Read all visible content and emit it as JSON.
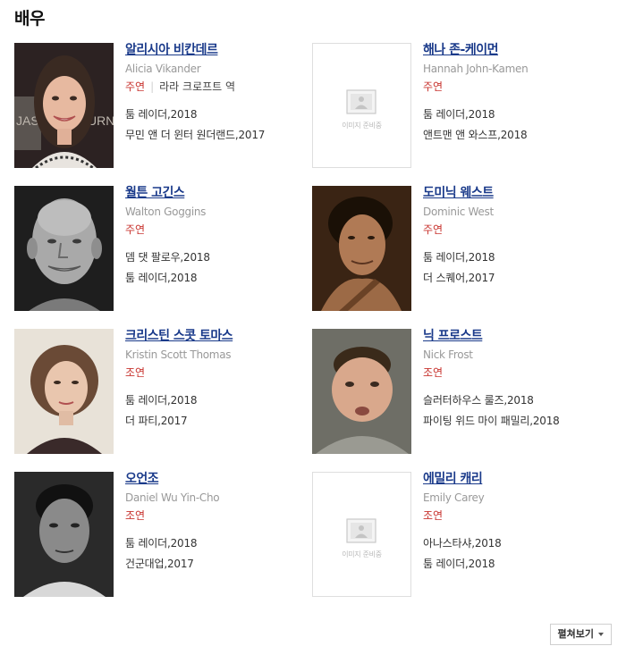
{
  "section": {
    "title": "배우"
  },
  "no_image_text": "이미지 준비중",
  "cast": [
    {
      "name": "알리시아 비칸데르",
      "english": "Alicia Vikander",
      "role": "주연",
      "character": "라라 크로프트 역",
      "works": [
        "툼 레이더,2018",
        "무민 앤 더 윈터 원더랜드,2017"
      ],
      "photo": "woman-long-dark-hair"
    },
    {
      "name": "해나 존-케이먼",
      "english": "Hannah John-Kamen",
      "role": "주연",
      "character": "",
      "works": [
        "툼 레이더,2018",
        "앤트맨 앤 와스프,2018"
      ],
      "photo": "placeholder"
    },
    {
      "name": "월튼 고긴스",
      "english": "Walton Goggins",
      "role": "주연",
      "character": "",
      "works": [
        "뎀 댓 팔로우,2018",
        "툼 레이더,2018"
      ],
      "photo": "man-bald-bw"
    },
    {
      "name": "도미닉 웨스트",
      "english": "Dominic West",
      "role": "주연",
      "character": "",
      "works": [
        "툼 레이더,2018",
        "더 스퀘어,2017"
      ],
      "photo": "man-dark-curly"
    },
    {
      "name": "크리스틴 스콧 토마스",
      "english": "Kristin Scott Thomas",
      "role": "조연",
      "character": "",
      "works": [
        "툼 레이더,2018",
        "더 파티,2017"
      ],
      "photo": "woman-short-hair"
    },
    {
      "name": "닉 프로스트",
      "english": "Nick Frost",
      "role": "조연",
      "character": "",
      "works": [
        "슬러터하우스 룰즈,2018",
        "파이팅 위드 마이 패밀리,2018"
      ],
      "photo": "man-round-face"
    },
    {
      "name": "오언조",
      "english": "Daniel Wu Yin-Cho",
      "role": "조연",
      "character": "",
      "works": [
        "툼 레이더,2018",
        "건군대업,2017"
      ],
      "photo": "man-bw-young"
    },
    {
      "name": "에밀리 캐리",
      "english": "Emily Carey",
      "role": "조연",
      "character": "",
      "works": [
        "아나스타샤,2018",
        "툼 레이더,2018"
      ],
      "photo": "placeholder"
    }
  ],
  "more_button": {
    "label": "펼쳐보기"
  }
}
